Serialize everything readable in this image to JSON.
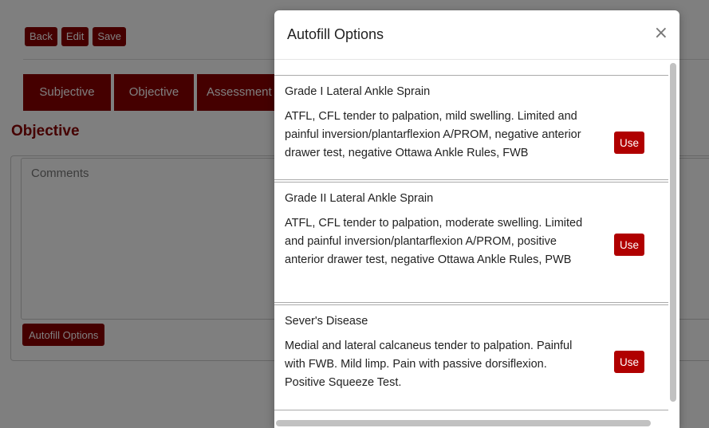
{
  "toolbar": {
    "back": "Back",
    "edit": "Edit",
    "save": "Save"
  },
  "tabs": [
    "Subjective",
    "Objective",
    "Assessment"
  ],
  "section_title": "Objective",
  "comments": {
    "placeholder": "Comments"
  },
  "autofill_button": "Autofill Options",
  "modal": {
    "title": "Autofill Options",
    "close": "×",
    "options": [
      {
        "title": "Grade I Lateral Ankle Sprain",
        "text": "ATFL, CFL tender to palpation, mild swelling. Limited and painful inversion/plantarflexion A/PROM, negative anterior drawer test, negative Ottawa Ankle Rules, FWB",
        "button": "Use"
      },
      {
        "title": "Grade II Lateral Ankle Sprain",
        "text": "ATFL, CFL tender to palpation, moderate swelling. Limited and painful inversion/plantarflexion A/PROM, positive anterior drawer test, negative Ottawa Ankle Rules, PWB",
        "button": "Use"
      },
      {
        "title": "Sever's Disease",
        "text": "Medial and lateral calcaneus tender to palpation. Painful with FWB. Mild limp. Pain with passive dorsiflexion. Positive Squeeze Test.",
        "button": "Use"
      }
    ]
  },
  "colors": {
    "brand": "#8b0000",
    "use_button": "#b00000"
  }
}
